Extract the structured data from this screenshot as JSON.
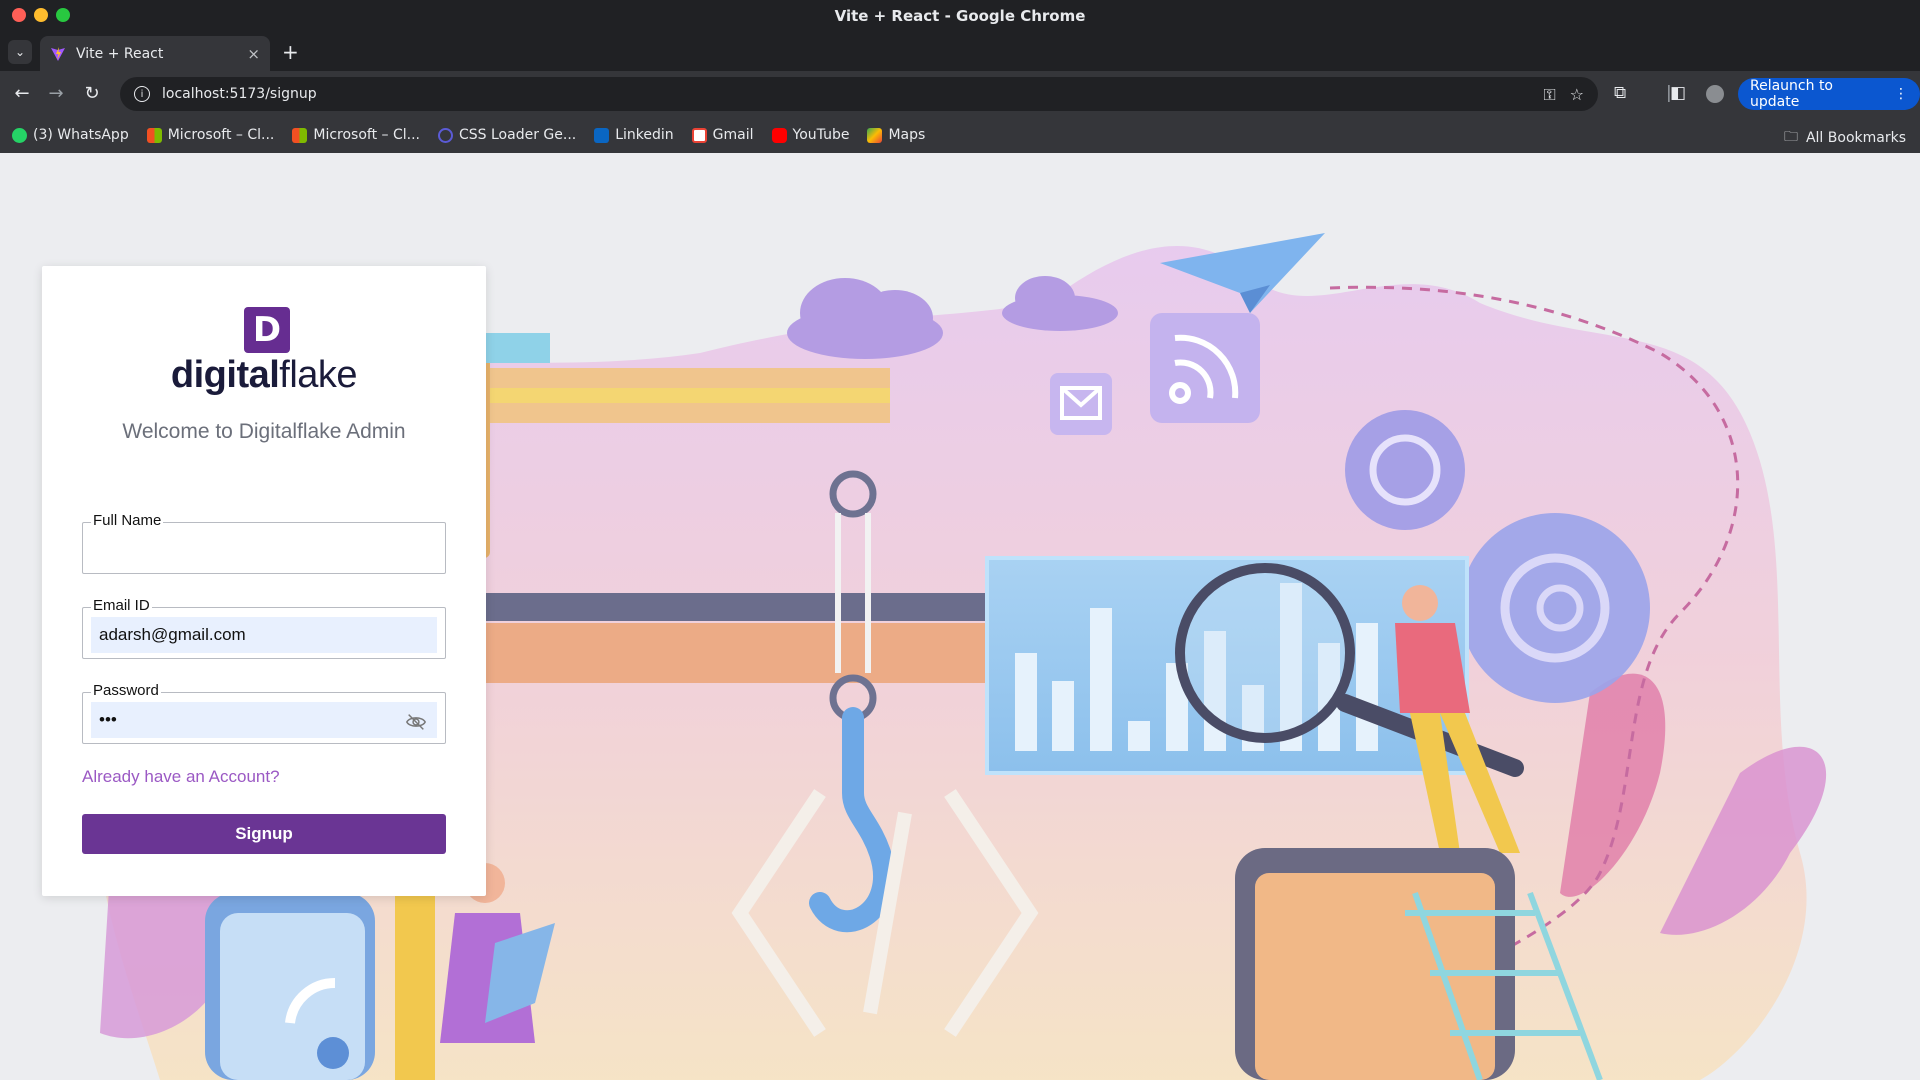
{
  "window": {
    "title": "Vite + React - Google Chrome"
  },
  "tabs": [
    {
      "title": "Vite + React",
      "close_label": "×"
    }
  ],
  "toolbar": {
    "url": "localhost:5173/signup",
    "relaunch_label": "Relaunch to update"
  },
  "bookmarks": [
    {
      "label": "(3) WhatsApp",
      "color": "#25d366"
    },
    {
      "label": "Microsoft – Cl...",
      "color": "#f25022"
    },
    {
      "label": "Microsoft – Cl...",
      "color": "#7fba00"
    },
    {
      "label": "CSS Loader Ge...",
      "color": "#5b5bd6"
    },
    {
      "label": "Linkedin",
      "color": "#0a66c2"
    },
    {
      "label": "Gmail",
      "color": "#ea4335"
    },
    {
      "label": "YouTube",
      "color": "#ff0000"
    },
    {
      "label": "Maps",
      "color": "#34a853"
    }
  ],
  "all_bookmarks_label": "All Bookmarks",
  "form": {
    "brand_bold": "digital",
    "brand_light": "flake",
    "logo_letter": "D",
    "welcome": "Welcome to Digitalflake Admin",
    "full_name": {
      "label": "Full Name",
      "value": ""
    },
    "email": {
      "label": "Email ID",
      "value": "adarsh@gmail.com"
    },
    "password": {
      "label": "Password",
      "value": "•••"
    },
    "already_link": "Already have an Account?",
    "signup_label": "Signup"
  },
  "colors": {
    "accent": "#6a3594",
    "link": "#9b59c4",
    "brand": "#662d91"
  }
}
